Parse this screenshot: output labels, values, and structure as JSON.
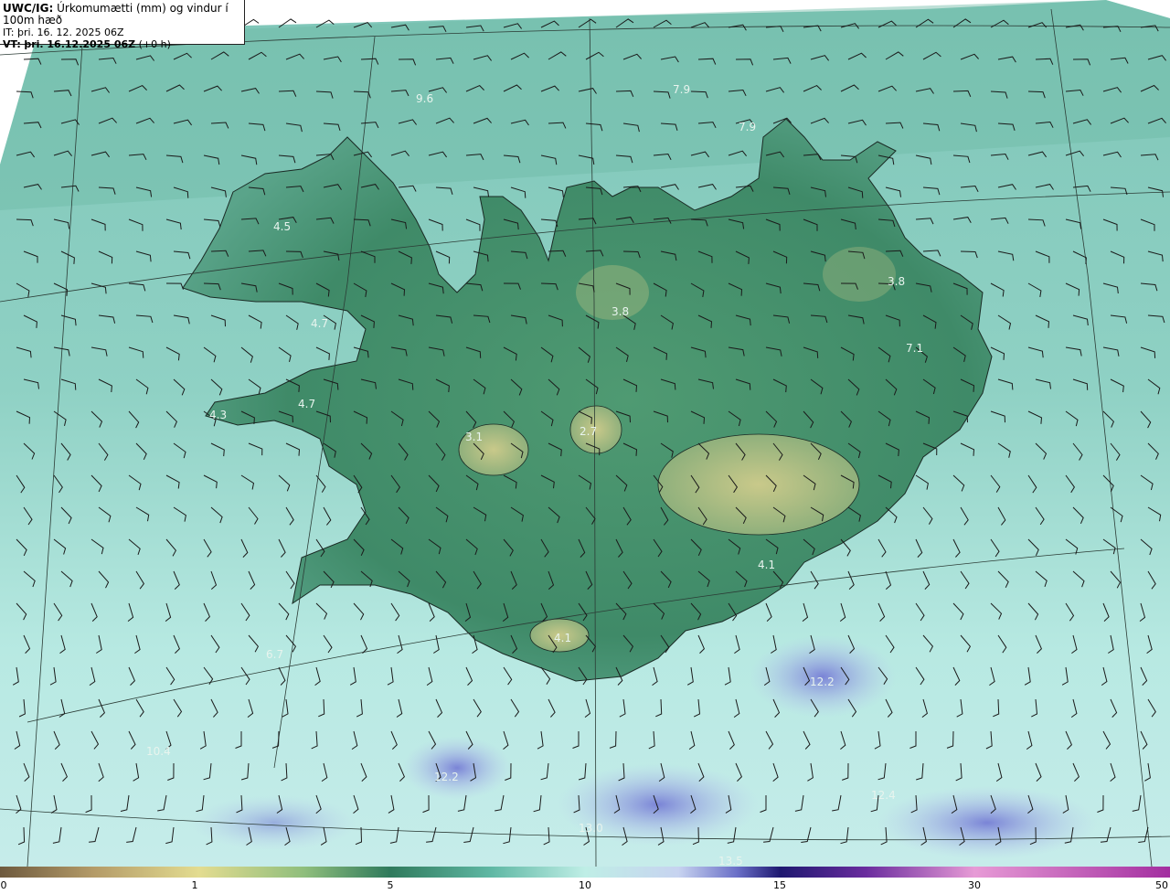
{
  "header": {
    "model": "UWC/IG:",
    "title": "Úrkomumætti (mm) og vindur í 100m hæð",
    "it_label": "IT:",
    "it_value": "þri. 16. 12. 2025 06Z",
    "vt_label": "VT:",
    "vt_value": "þri. 16.12.2025 06Z",
    "vt_offset": "(+0 h)"
  },
  "map_values": [
    {
      "id": "v1",
      "text": "9.6"
    },
    {
      "id": "v2",
      "text": "7.9"
    },
    {
      "id": "v3",
      "text": "7.9"
    },
    {
      "id": "v4",
      "text": "4.5"
    },
    {
      "id": "v5",
      "text": "3.8"
    },
    {
      "id": "v6",
      "text": "3.8"
    },
    {
      "id": "v7",
      "text": "7.1"
    },
    {
      "id": "v8",
      "text": "4.7"
    },
    {
      "id": "v9",
      "text": "4.7"
    },
    {
      "id": "v10",
      "text": "4.3"
    },
    {
      "id": "v11",
      "text": "3.1"
    },
    {
      "id": "v12",
      "text": "2.7"
    },
    {
      "id": "v13",
      "text": "4.1"
    },
    {
      "id": "v14",
      "text": "4.1"
    },
    {
      "id": "v15",
      "text": "6.7"
    },
    {
      "id": "v16",
      "text": "10.4"
    },
    {
      "id": "v17",
      "text": "12.2"
    },
    {
      "id": "v18",
      "text": "12.2"
    },
    {
      "id": "v19",
      "text": "13.0"
    },
    {
      "id": "v20",
      "text": "13.5"
    },
    {
      "id": "v21",
      "text": "12.4"
    }
  ],
  "colorbar": {
    "ticks": [
      "0",
      "1",
      "5",
      "10",
      "15",
      "30",
      "50"
    ],
    "colors": [
      "#6e5a3e",
      "#b49b68",
      "#e3dc90",
      "#8fbe7c",
      "#2f7a5c",
      "#5fb8a4",
      "#bfeee6",
      "#c7d3f0",
      "#6a6fc7",
      "#1e1870",
      "#6a2c9e",
      "#e79bd6",
      "#a32ea0"
    ]
  },
  "legend_unit": "mm"
}
